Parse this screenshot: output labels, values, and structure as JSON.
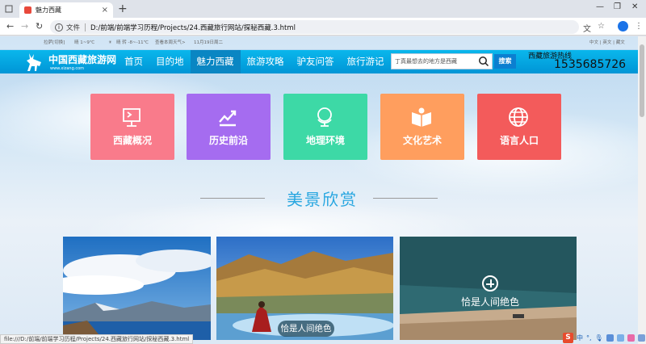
{
  "browser": {
    "tab_title": "魅力西藏",
    "tab_close": "×",
    "new_tab": "+",
    "file_label": "文件",
    "url": "D:/前端/前端学习历程/Projects/24.西藏旅行网站/探秘西藏.3.html",
    "status_url": "file:///D:/前端/前端学习历程/Projects/24.西藏旅行网站/探秘西藏.3.html"
  },
  "topbar": {
    "location": "拉萨[切换]",
    "weather1": "晴  1~9℃",
    "weather2": "晴 转 -8~-11℃",
    "weather_link": "查看本周天气>",
    "date": "11月19日周二",
    "lang": "中文 | 英文 | 藏文"
  },
  "header": {
    "logo_text": "中国西藏旅游网",
    "logo_domain": "www.xizang.com",
    "menu": [
      {
        "label": "首页",
        "active": false
      },
      {
        "label": "目的地",
        "active": false
      },
      {
        "label": "魅力西藏",
        "active": true
      },
      {
        "label": "旅游攻略",
        "active": false
      },
      {
        "label": "驴友问答",
        "active": false
      },
      {
        "label": "旅行游记",
        "active": false
      }
    ],
    "search_placeholder": "丁真最想去的地方是西藏",
    "search_button": "搜索",
    "hotline_label": "西藏旅游热线",
    "hotline_number": "1535685726"
  },
  "tiles": [
    {
      "label": "西藏概况",
      "color": "#f97b8b",
      "icon": "flag-icon"
    },
    {
      "label": "历史前沿",
      "color": "#a56cf0",
      "icon": "trend-icon"
    },
    {
      "label": "地理环境",
      "color": "#3dd9a6",
      "icon": "globe-icon"
    },
    {
      "label": "文化艺术",
      "color": "#ff9e5e",
      "icon": "book-icon"
    },
    {
      "label": "语言人口",
      "color": "#f35b5b",
      "icon": "world-icon"
    }
  ],
  "section": {
    "title": "美景欣赏"
  },
  "photos": [
    {
      "caption": ""
    },
    {
      "caption": "恰是人间绝色"
    },
    {
      "caption": "恰是人间绝色"
    }
  ],
  "tray": {
    "lang": "中",
    "logo": "S"
  }
}
